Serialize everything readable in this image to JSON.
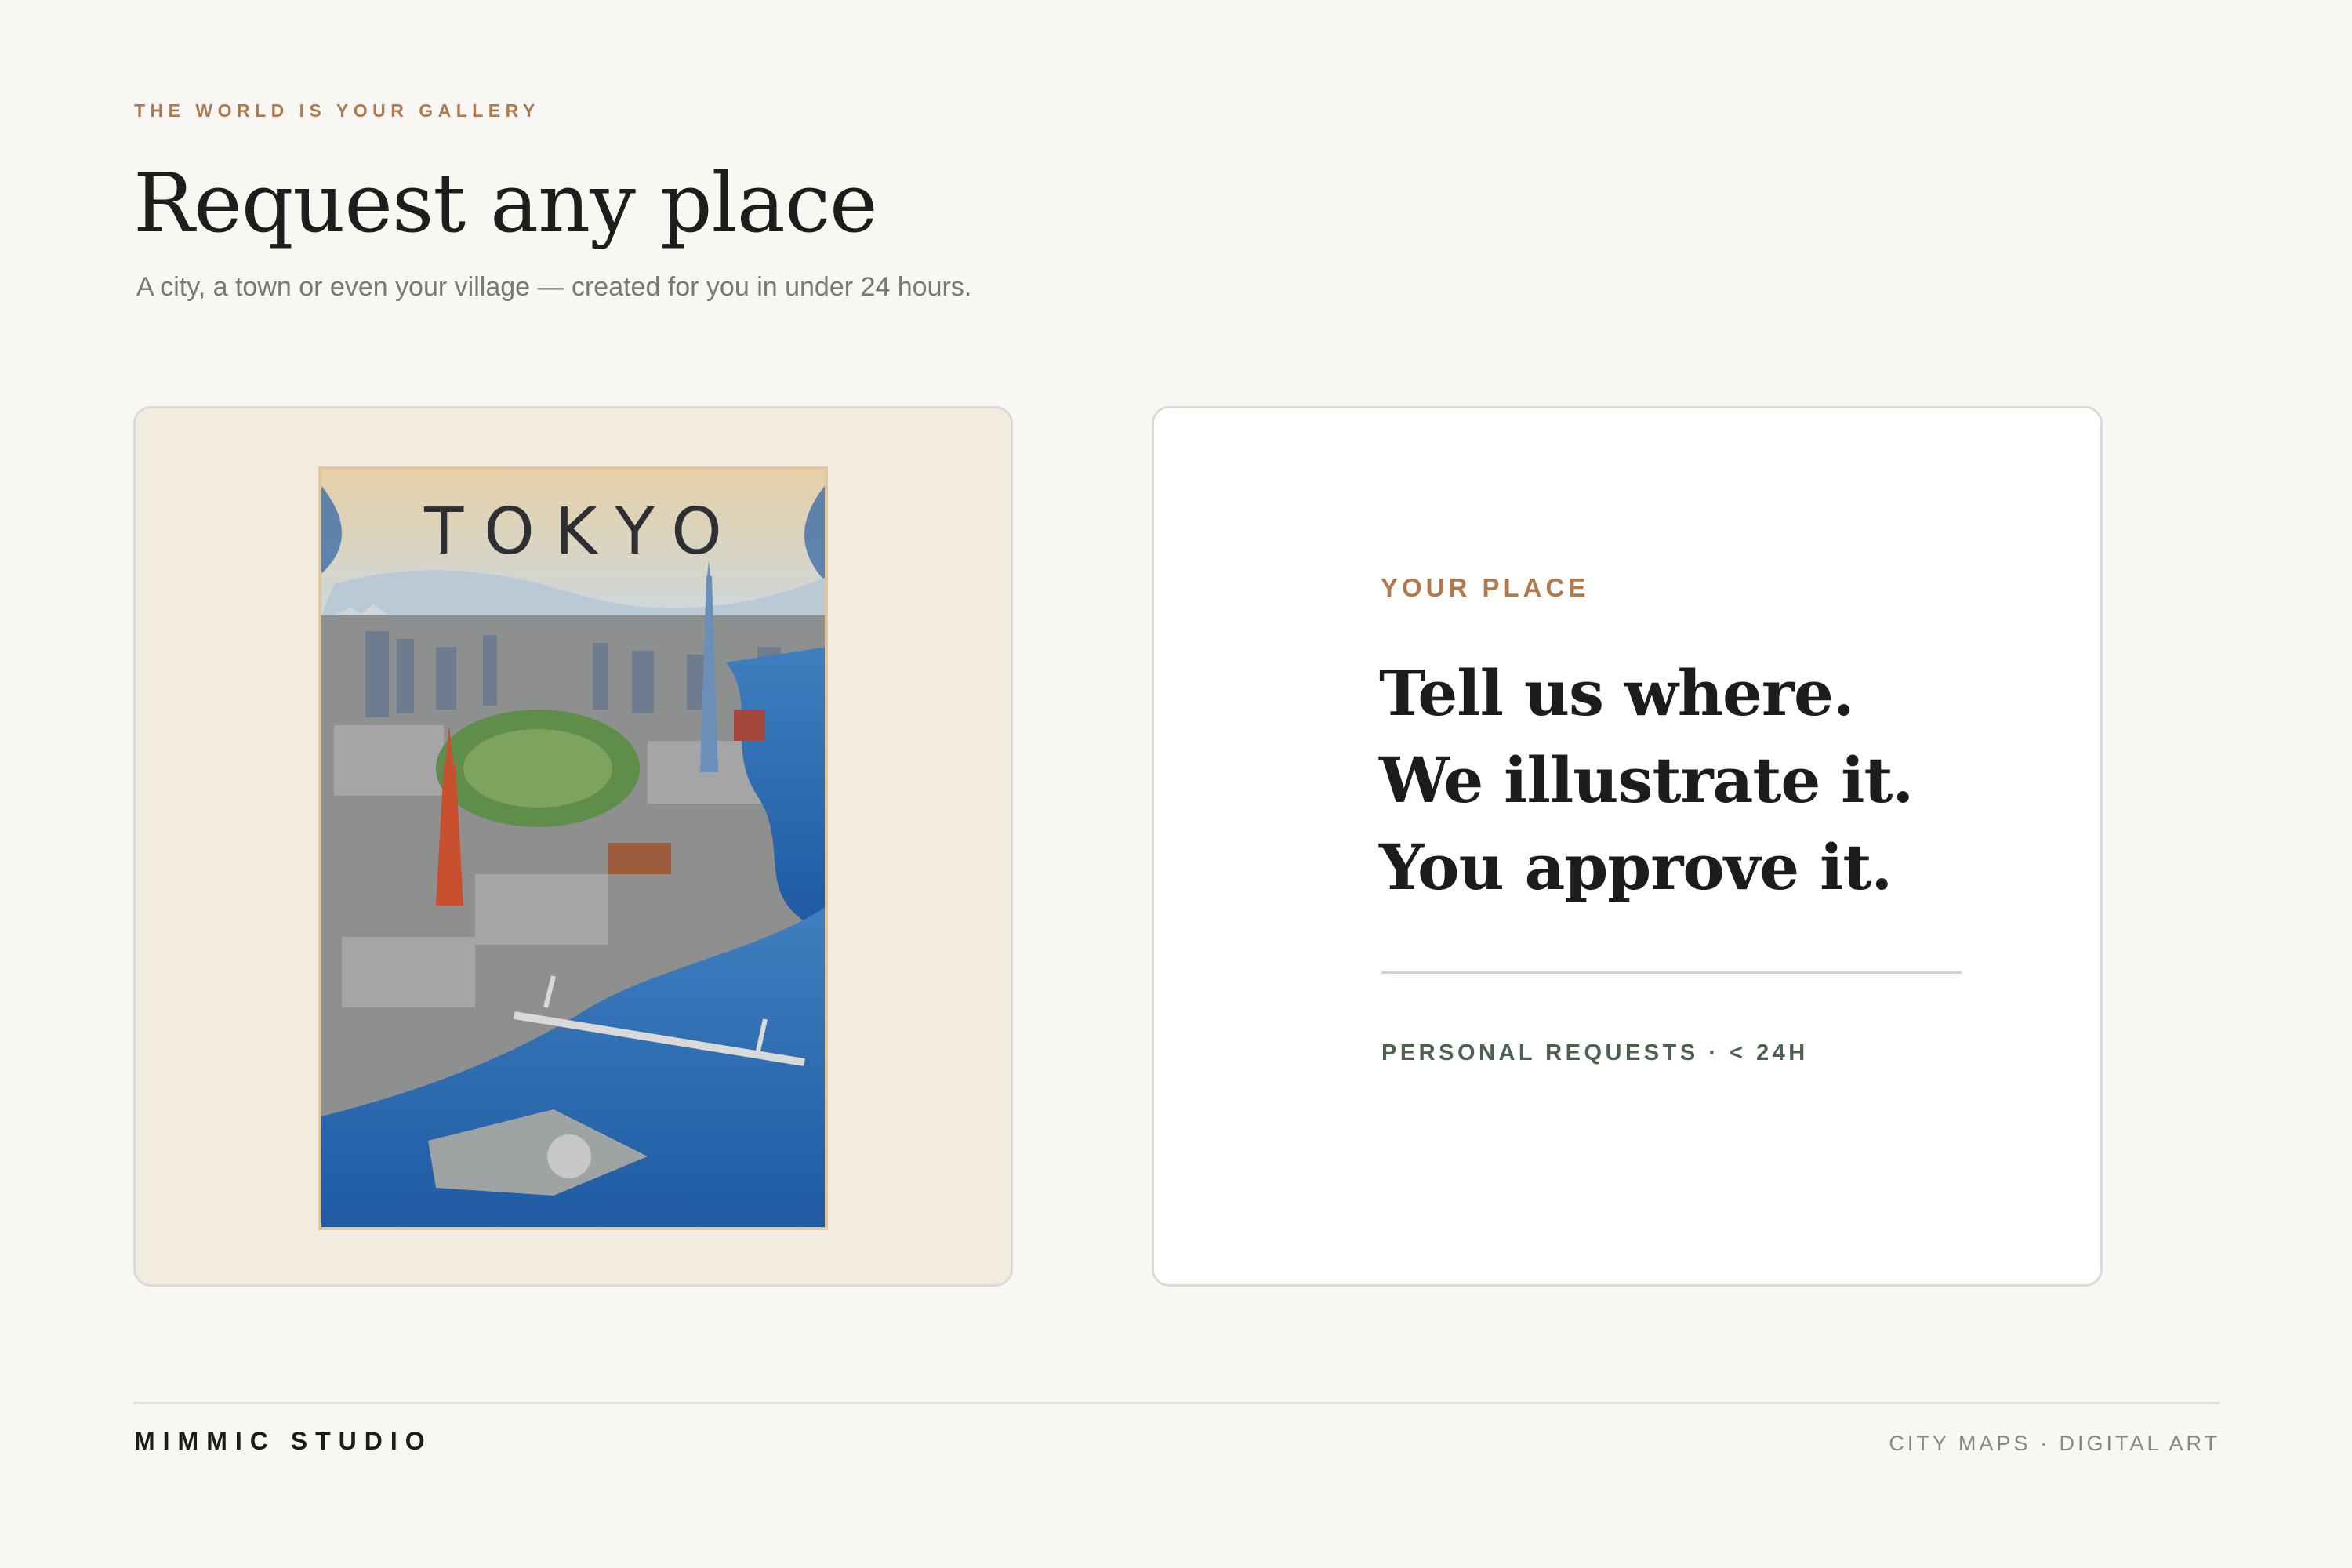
{
  "header": {
    "eyebrow": "THE WORLD IS YOUR GALLERY",
    "title": "Request any place",
    "subtitle": "A city, a town or even your village — created for you in under 24 hours."
  },
  "poster": {
    "title": "TOKYO",
    "image_subject": "tokyo-illustrated-map"
  },
  "info_card": {
    "kicker": "YOUR PLACE",
    "headline": [
      "Tell us where.",
      "We illustrate it.",
      "You approve it."
    ],
    "tagline": "PERSONAL REQUESTS · < 24H"
  },
  "footer": {
    "brand": "MIMMIC STUDIO",
    "right_text": "CITY MAPS · DIGITAL ART"
  },
  "colors": {
    "accent": "#b07a4e",
    "green": "#4d6150",
    "background": "#f8f7f4",
    "card_image_bg": "#f2ebe0"
  }
}
